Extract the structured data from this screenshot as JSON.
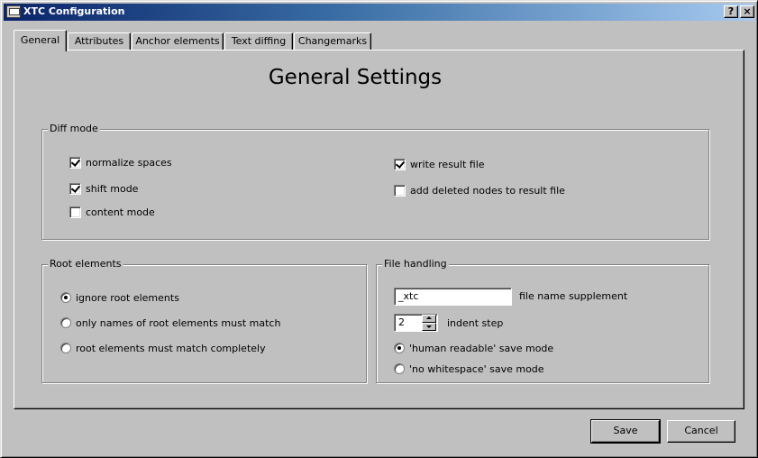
{
  "window": {
    "title": "XTC Configuration",
    "help_label": "?",
    "close_label": "×"
  },
  "tabs": [
    {
      "label": "General",
      "active": true
    },
    {
      "label": "Attributes",
      "active": false
    },
    {
      "label": "Anchor elements",
      "active": false
    },
    {
      "label": "Text diffing",
      "active": false
    },
    {
      "label": "Changemarks",
      "active": false
    }
  ],
  "general": {
    "heading": "General Settings",
    "diff_mode": {
      "title": "Diff mode",
      "normalize_spaces": {
        "label": "normalize spaces",
        "checked": true
      },
      "shift_mode": {
        "label": "shift mode",
        "checked": true
      },
      "content_mode": {
        "label": "content mode",
        "checked": false
      },
      "write_result_file": {
        "label": "write result file",
        "checked": true
      },
      "add_deleted_nodes": {
        "label": "add deleted nodes to result file",
        "checked": false
      }
    },
    "root_elements": {
      "title": "Root elements",
      "options": [
        {
          "label": "ignore root elements",
          "selected": true
        },
        {
          "label": "only names of root elements must match",
          "selected": false
        },
        {
          "label": "root elements must match completely",
          "selected": false
        }
      ]
    },
    "file_handling": {
      "title": "File handling",
      "file_name_supplement": {
        "value": "_xtc",
        "label": "file name supplement"
      },
      "indent_step": {
        "value": "2",
        "label": "indent step"
      },
      "save_modes": [
        {
          "label": "'human readable' save mode",
          "selected": true
        },
        {
          "label": "'no whitespace' save mode",
          "selected": false
        }
      ]
    }
  },
  "buttons": {
    "save": "Save",
    "cancel": "Cancel"
  }
}
